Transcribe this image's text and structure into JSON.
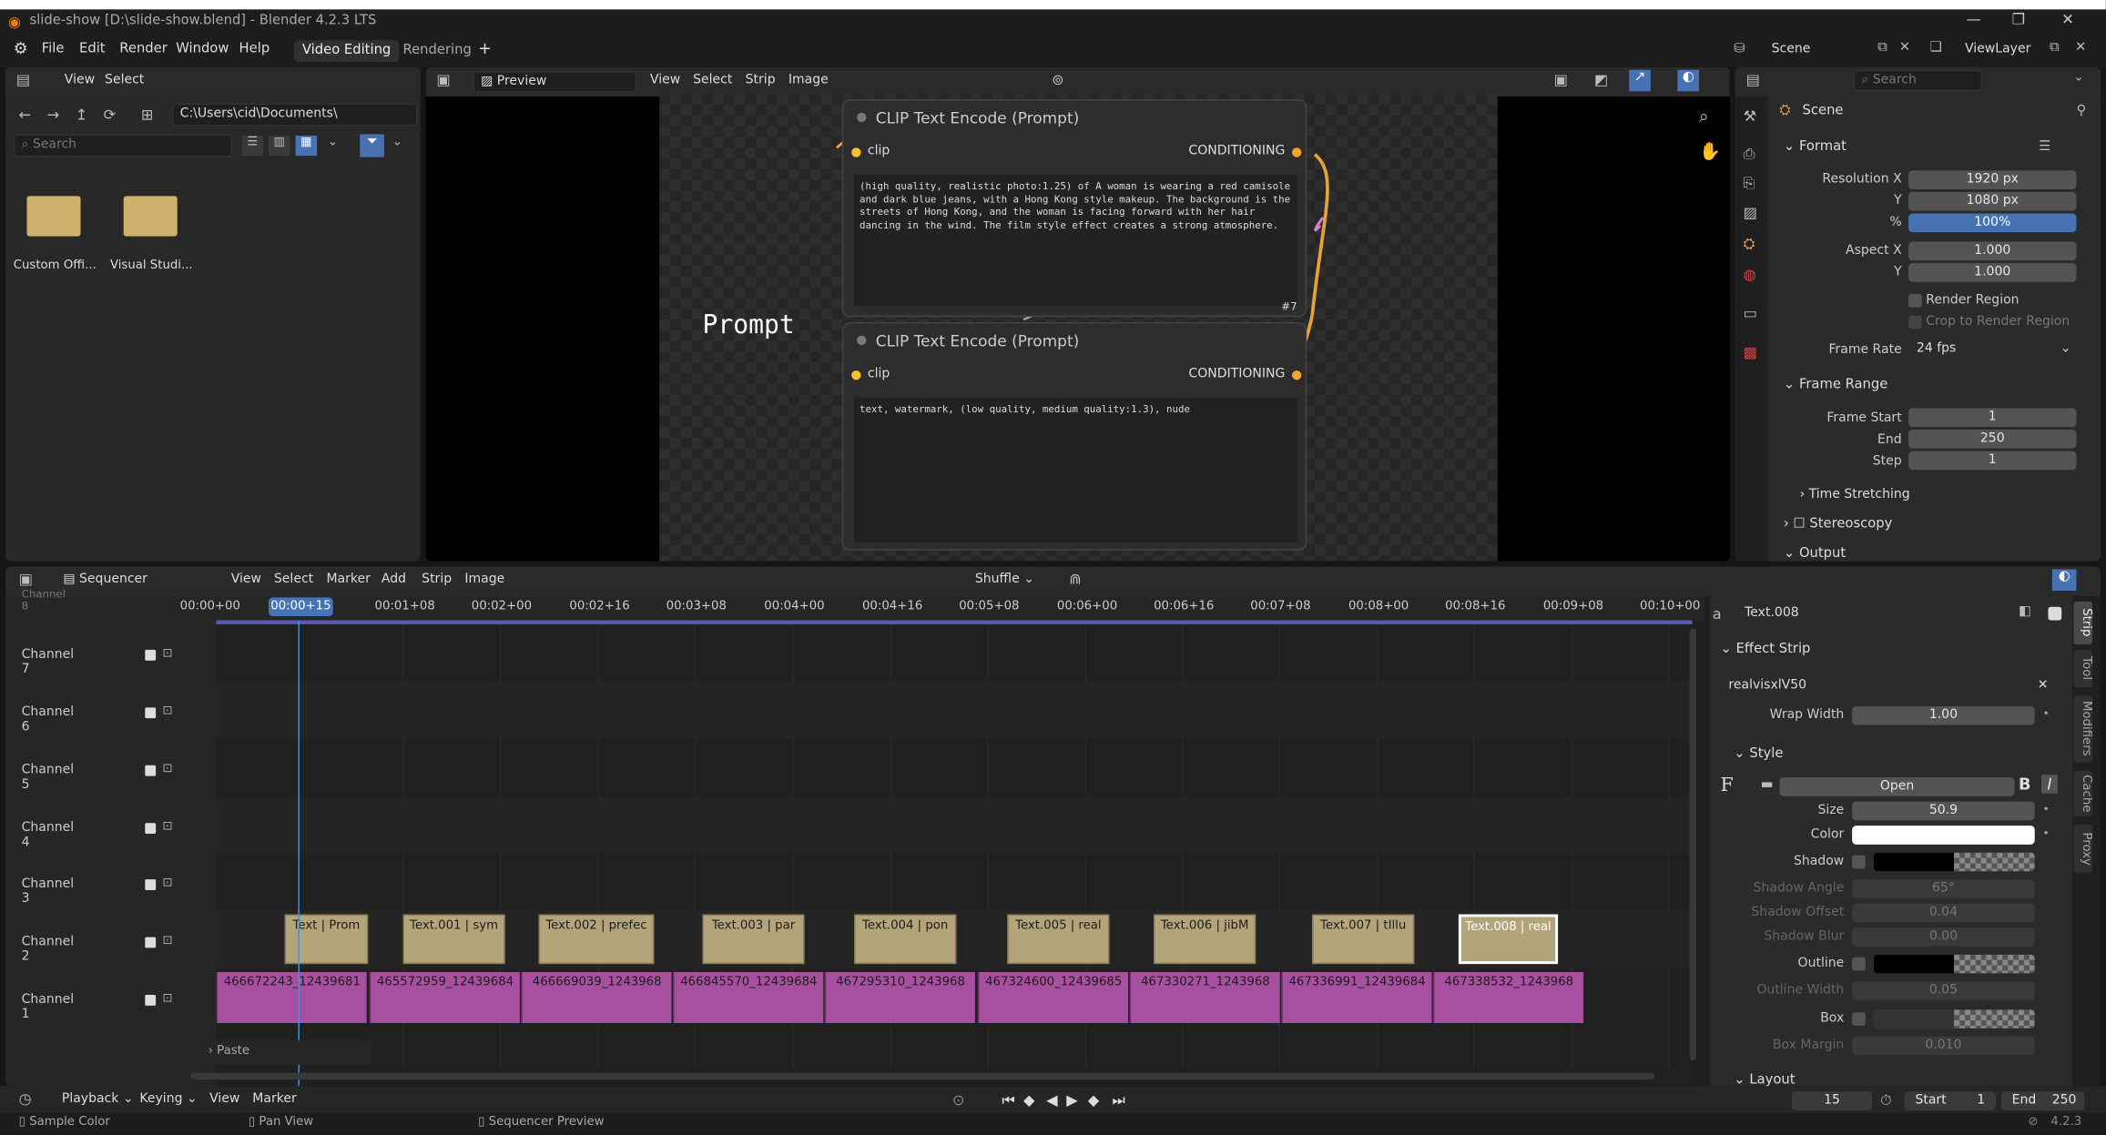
{
  "window": {
    "title": "slide-show [D:\\slide-show.blend] - Blender 4.2.3 LTS",
    "controls": [
      "—",
      "❐",
      "✕"
    ]
  },
  "menu": {
    "items": [
      "File",
      "Edit",
      "Render",
      "Window",
      "Help"
    ],
    "workspaces": [
      {
        "label": "Video Editing",
        "active": true
      },
      {
        "label": "Rendering",
        "active": false
      }
    ],
    "add": "+",
    "scene": "Scene",
    "viewlayer": "ViewLayer"
  },
  "filebrowser": {
    "menus": [
      "View",
      "Select"
    ],
    "path": "C:\\Users\\cid\\Documents\\",
    "search_placeholder": "Search",
    "folders": [
      {
        "label": "Custom Offi..."
      },
      {
        "label": "Visual Studi..."
      }
    ]
  },
  "preview": {
    "mode": "Preview",
    "menus": [
      "View",
      "Select",
      "Strip",
      "Image"
    ],
    "prompt_label": "Prompt",
    "node_badge": "#7",
    "nodes": [
      {
        "title": "CLIP Text Encode (Prompt)",
        "input": "clip",
        "output": "CONDITIONING",
        "text": "(high quality, realistic photo:1.25) of A woman is wearing a red camisole and dark blue jeans, with a Hong Kong style makeup. The background is the streets of Hong Kong, and the woman is facing forward with her hair dancing in the wind. The film style effect creates a strong atmosphere."
      },
      {
        "title": "CLIP Text Encode (Prompt)",
        "input": "clip",
        "output": "CONDITIONING",
        "text": "text, watermark, (low quality, medium quality:1.3), nude"
      }
    ]
  },
  "properties": {
    "search_placeholder": "Search",
    "scene_label": "Scene",
    "format": {
      "title": "Format",
      "resolution_x_label": "Resolution X",
      "resolution_x": "1920 px",
      "y_label": "Y",
      "resolution_y": "1080 px",
      "percent_label": "%",
      "percent": "100%",
      "aspect_x_label": "Aspect X",
      "aspect_x": "1.000",
      "aspect_y_label": "Y",
      "aspect_y": "1.000",
      "render_region": "Render Region",
      "crop": "Crop to Render Region",
      "frame_rate_label": "Frame Rate",
      "frame_rate": "24 fps"
    },
    "frame_range": {
      "title": "Frame Range",
      "start_label": "Frame Start",
      "start": "1",
      "end_label": "End",
      "end": "250",
      "step_label": "Step",
      "step": "1"
    },
    "time_stretching": "Time Stretching",
    "stereoscopy": "Stereoscopy",
    "output": "Output"
  },
  "sequencer": {
    "editor": "Sequencer",
    "menus": [
      "View",
      "Select",
      "Marker",
      "Add",
      "Strip",
      "Image"
    ],
    "snap": "Shuffle",
    "current_time": "00:00+15",
    "ticks": [
      "00:00+00",
      "00:00+15",
      "00:01+08",
      "00:02+00",
      "00:02+16",
      "00:03+08",
      "00:04+00",
      "00:04+16",
      "00:05+08",
      "00:06+00",
      "00:06+16",
      "00:07+08",
      "00:08+00",
      "00:08+16",
      "00:09+08",
      "00:10+00"
    ],
    "channels": [
      "Channel 8",
      "Channel 7",
      "Channel 6",
      "Channel 5",
      "Channel 4",
      "Channel 3",
      "Channel 2",
      "Channel 1"
    ],
    "text_strips": [
      "Text | Prom",
      "Text.001 | sym",
      "Text.002 | prefec",
      "Text.003 | par",
      "Text.004 | pon",
      "Text.005 | real",
      "Text.006 | jibM",
      "Text.007 | tIllu",
      "Text.008 | real"
    ],
    "image_strips": [
      "466672243_12439681",
      "465572959_12439684",
      "466669039_1243968",
      "466845570_12439684",
      "467295310_1243968",
      "467324600_12439685",
      "467330271_1243968",
      "467336991_12439684",
      "467338532_1243968"
    ],
    "paste": "Paste"
  },
  "strip_panel": {
    "name": "Text.008",
    "effect_title": "Effect Strip",
    "text_value": "realvisxlV50",
    "wrap_width_label": "Wrap Width",
    "wrap_width": "1.00",
    "style_title": "Style",
    "font_open": "Open",
    "size_label": "Size",
    "size": "50.9",
    "color_label": "Color",
    "shadow_label": "Shadow",
    "shadow_angle_label": "Shadow Angle",
    "shadow_angle": "65°",
    "shadow_offset_label": "Shadow Offset",
    "shadow_offset": "0.04",
    "shadow_blur_label": "Shadow Blur",
    "shadow_blur": "0.00",
    "outline_label": "Outline",
    "outline_width_label": "Outline Width",
    "outline_width": "0.05",
    "box_label": "Box",
    "box_margin_label": "Box Margin",
    "box_margin": "0.010",
    "layout_title": "Layout",
    "tabs": [
      "Strip",
      "Tool",
      "Modifiers",
      "Cache",
      "Proxy"
    ]
  },
  "timeline": {
    "menus": [
      "Playback",
      "Keying",
      "View",
      "Marker"
    ],
    "frame": "15",
    "start_label": "Start",
    "start": "1",
    "end_label": "End",
    "end": "250"
  },
  "statusbar": {
    "items": [
      "Sample Color",
      "Pan View",
      "Sequencer Preview"
    ],
    "version": "4.2.3"
  }
}
